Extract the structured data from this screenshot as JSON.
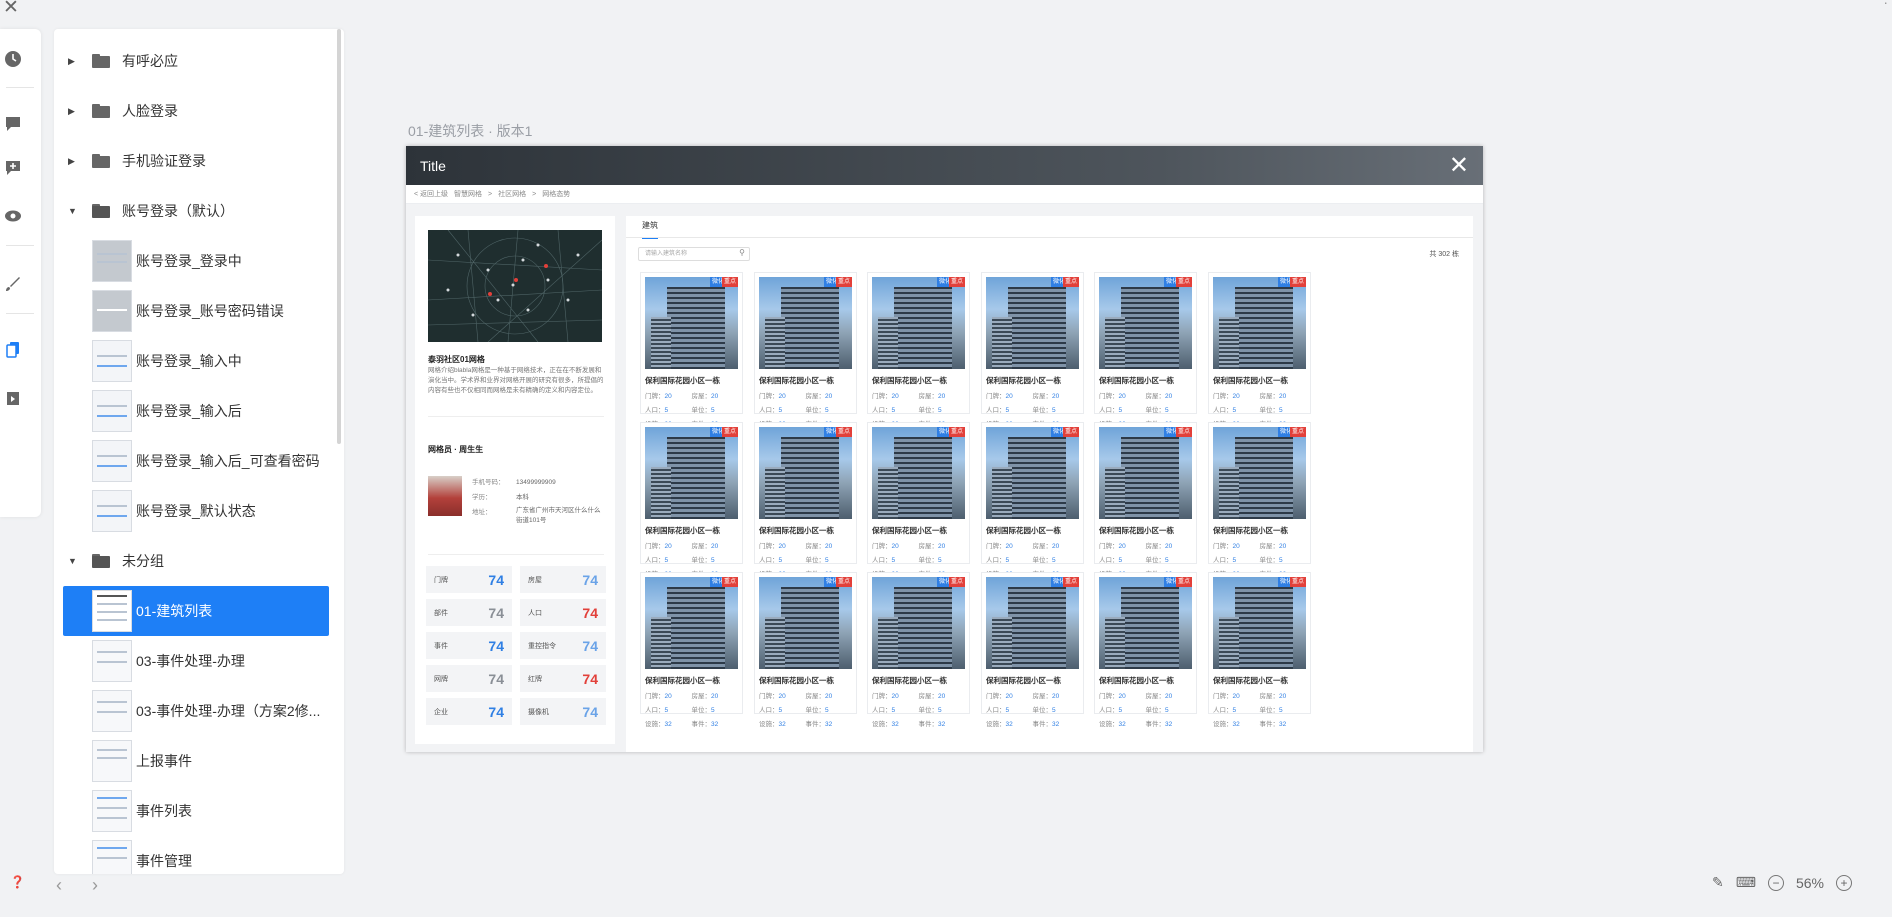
{
  "tree": {
    "items": [
      {
        "label": "有呼必应",
        "type": "folder",
        "open": false
      },
      {
        "label": "人脸登录",
        "type": "folder",
        "open": false
      },
      {
        "label": "手机验证登录",
        "type": "folder",
        "open": false
      },
      {
        "label": "账号登录（默认）",
        "type": "folder",
        "open": true
      },
      {
        "label": "账号登录_登录中",
        "type": "page"
      },
      {
        "label": "账号登录_账号密码错误",
        "type": "page"
      },
      {
        "label": "账号登录_输入中",
        "type": "page"
      },
      {
        "label": "账号登录_输入后",
        "type": "page"
      },
      {
        "label": "账号登录_输入后_可查看密码",
        "type": "page"
      },
      {
        "label": "账号登录_默认状态",
        "type": "page"
      },
      {
        "label": "未分组",
        "type": "folder",
        "open": true
      },
      {
        "label": "01-建筑列表",
        "type": "page",
        "selected": true
      },
      {
        "label": "03-事件处理-办理",
        "type": "page"
      },
      {
        "label": "03-事件处理-办理（方案2修...",
        "type": "page"
      },
      {
        "label": "上报事件",
        "type": "page"
      },
      {
        "label": "事件列表",
        "type": "page"
      },
      {
        "label": "事件管理",
        "type": "page"
      }
    ]
  },
  "rail_icons": [
    "history-icon",
    "comment-icon",
    "add-comment-icon",
    "preview-icon",
    "brush-icon",
    "pages-icon",
    "components-icon"
  ],
  "canvas": {
    "page_title": "01-建筑列表 · 版本1",
    "zoom": "56%"
  },
  "mock": {
    "window_title": "Title",
    "close": "✕",
    "breadcrumb": [
      "< 返回上级",
      "智慧网格",
      ">",
      "社区网格",
      ">",
      "网格态势"
    ],
    "left": {
      "grid_title": "泰羽社区01网格",
      "grid_desc": "网格介绍blabla网格是一种基于网络技术，正在在不断发展和演化当中。学术界和业界对网格开展的研究有很多，所提倡的内容有些也不仅相同而网格是未有精确的定义和内容定位。",
      "staff_title": "网格员 · 周生生",
      "phone_label": "手机号码：",
      "phone": "13499999909",
      "edu_label": "学历：",
      "edu": "本科",
      "addr_label": "地址：",
      "addr": "广东省广州市天河区什么什么街道101号",
      "stats": [
        {
          "label": "门牌",
          "value": "74",
          "color": "blue"
        },
        {
          "label": "房屋",
          "value": "74",
          "color": "lblue"
        },
        {
          "label": "部件",
          "value": "74",
          "color": "gray"
        },
        {
          "label": "人口",
          "value": "74",
          "color": "red"
        },
        {
          "label": "事件",
          "value": "74",
          "color": "blue"
        },
        {
          "label": "重控指令",
          "value": "74",
          "color": "lblue"
        },
        {
          "label": "网牌",
          "value": "74",
          "color": "gray"
        },
        {
          "label": "红牌",
          "value": "74",
          "color": "red"
        },
        {
          "label": "企业",
          "value": "74",
          "color": "blue"
        },
        {
          "label": "摄像机",
          "value": "74",
          "color": "lblue"
        }
      ]
    },
    "right": {
      "tab": "建筑",
      "search_placeholder": "请输入建筑名称",
      "total": "共 302 栋",
      "card": {
        "tag1": "微化",
        "tag2": "重点",
        "name": "保利国际花园小区一栋",
        "f1_label": "门牌：",
        "f1": "20",
        "f2_label": "房屋：",
        "f2": "20",
        "f3_label": "人口：",
        "f3": "5",
        "f4_label": "单位：",
        "f4": "5",
        "f5_label": "设施：",
        "f5": "32",
        "f6_label": "事件：",
        "f6": "32"
      }
    }
  },
  "colors": {
    "accent": "#1e7ff6",
    "blue": "#2f7fe4",
    "red": "#e2403a"
  }
}
